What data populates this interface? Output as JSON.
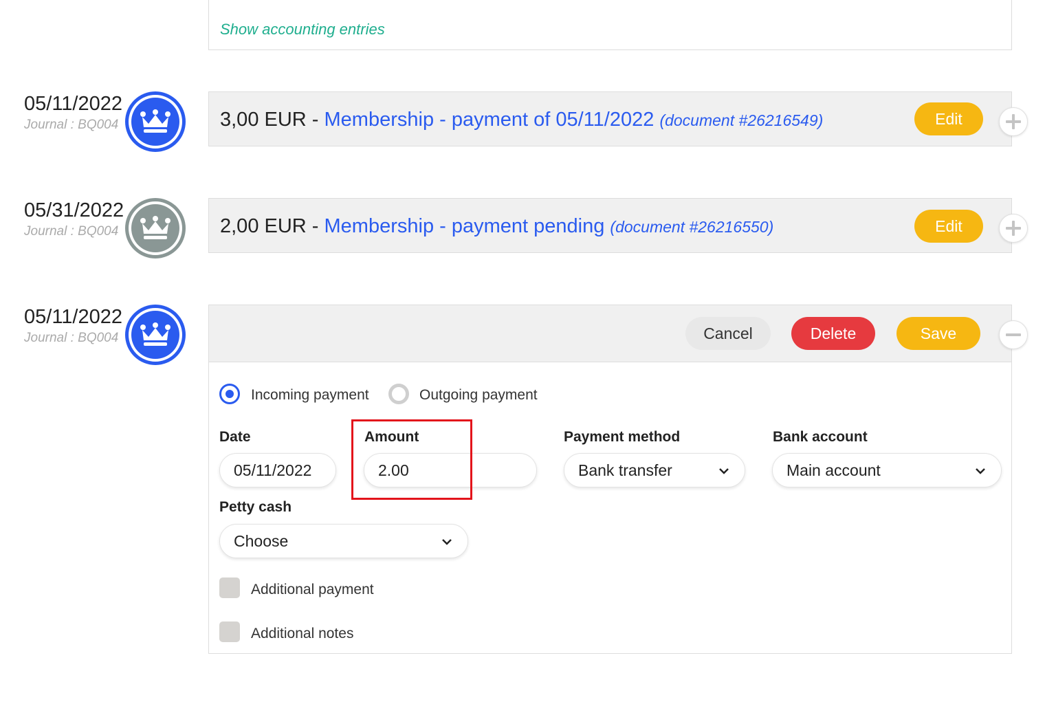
{
  "top_link": "Show accounting entries",
  "entries": [
    {
      "date": "05/11/2022",
      "journal": "Journal : BQ004",
      "amount": "3,00 EUR",
      "separator": " - ",
      "title": "Membership - payment of 05/11/2022",
      "document": "(document #26216549)",
      "edit_label": "Edit"
    },
    {
      "date": "05/31/2022",
      "journal": "Journal : BQ004",
      "amount": "2,00 EUR",
      "separator": " - ",
      "title": "Membership - payment pending",
      "document": "(document #26216550)",
      "edit_label": "Edit"
    }
  ],
  "editing": {
    "date": "05/11/2022",
    "journal": "Journal : BQ004",
    "cancel_label": "Cancel",
    "delete_label": "Delete",
    "save_label": "Save",
    "radio_incoming": "Incoming payment",
    "radio_outgoing": "Outgoing payment",
    "selected_direction": "incoming",
    "date_label": "Date",
    "date_value": "05/11/2022",
    "amount_label": "Amount",
    "amount_value": "2.00",
    "method_label": "Payment method",
    "method_value": "Bank transfer",
    "bank_label": "Bank account",
    "bank_value": "Main account",
    "petty_label": "Petty cash",
    "petty_value": "Choose",
    "additional_payment": "Additional payment",
    "additional_notes": "Additional notes"
  },
  "colors": {
    "accent_blue": "#2a5bef",
    "link_green": "#1fae8e",
    "edit_yellow": "#f6b712",
    "delete_red": "#e63a3f",
    "status_grey": "#8a9795",
    "highlight_red": "#e3141b"
  },
  "icons": [
    "crown-icon",
    "plus-icon",
    "minus-icon",
    "chevron-down-icon"
  ]
}
